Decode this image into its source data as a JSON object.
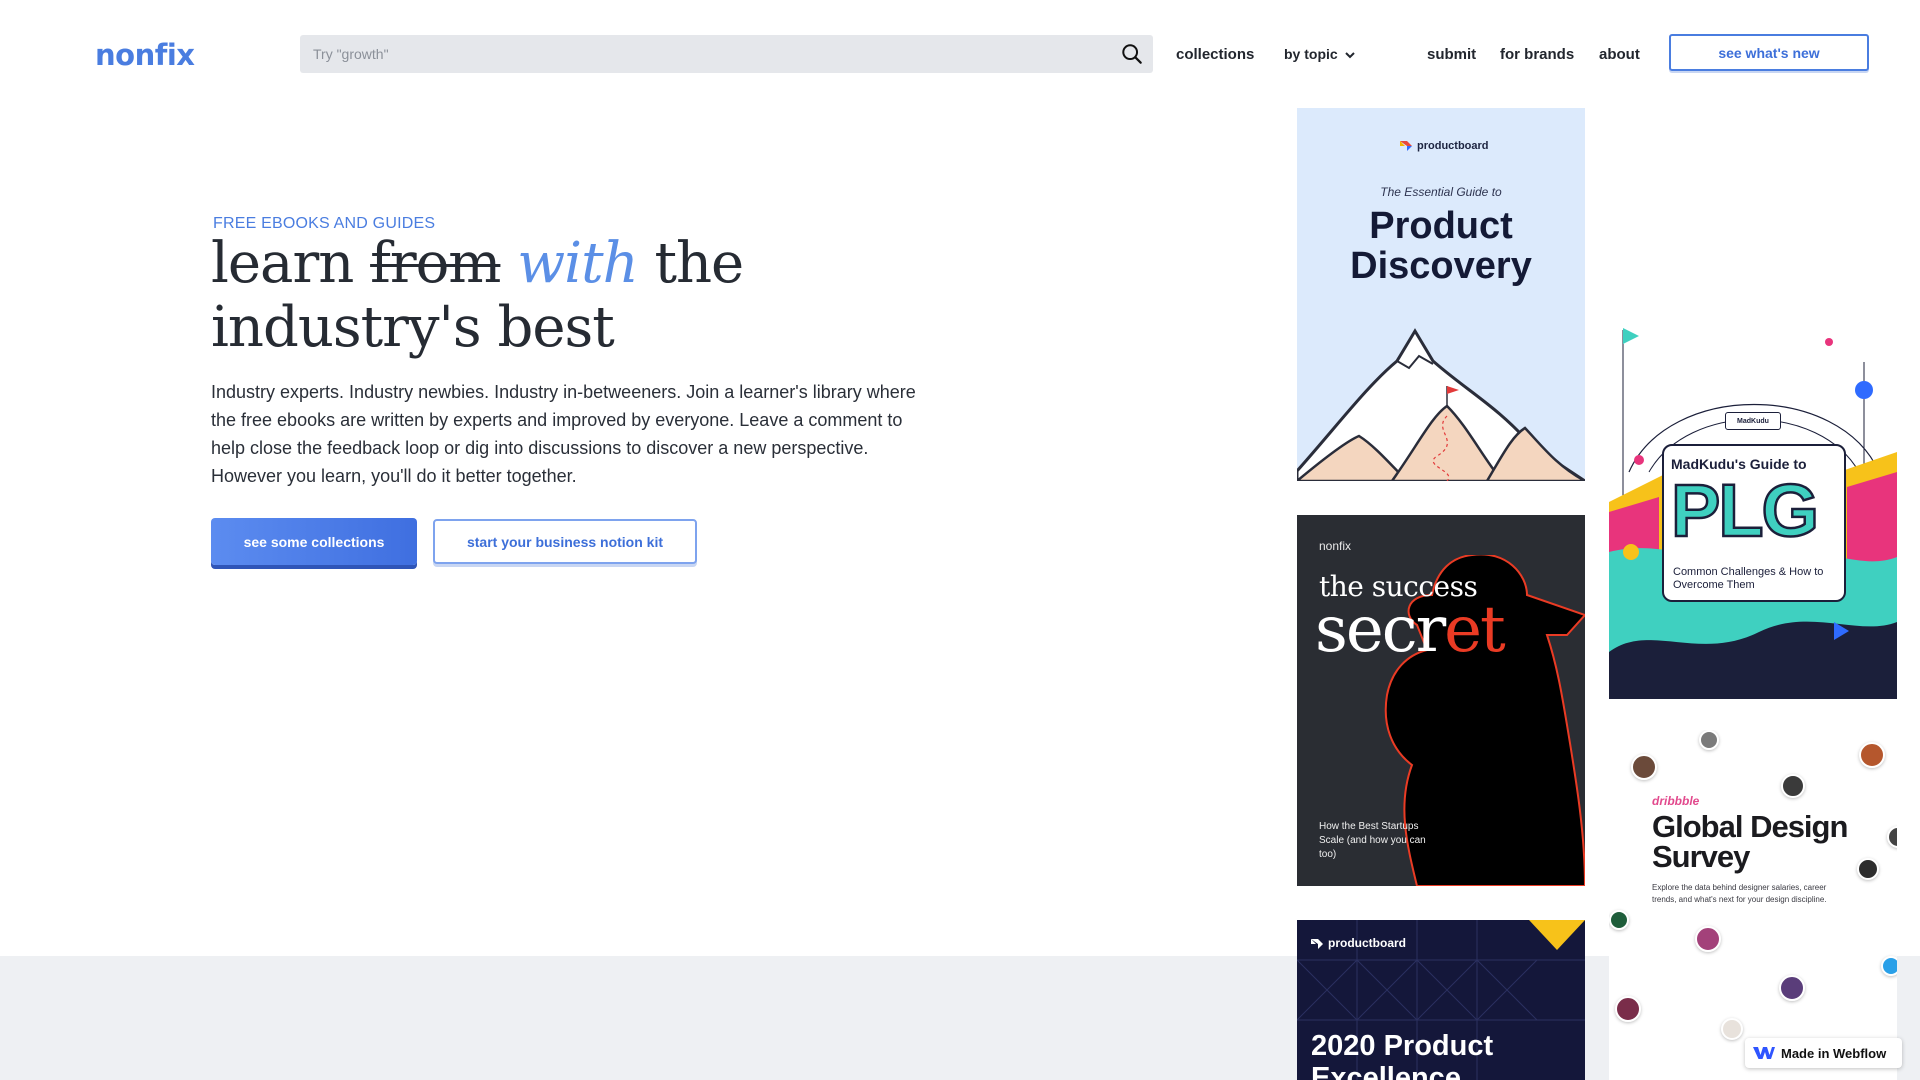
{
  "header": {
    "logo_text": "nonfi",
    "logo_mark": "x",
    "search_placeholder": "Try \"growth\"",
    "search_value": "",
    "nav": {
      "collections": "collections",
      "by_topic": "by topic",
      "submit": "submit",
      "for_brands": "for brands",
      "about": "about",
      "cta": "see what's new"
    }
  },
  "hero": {
    "eyebrow": "FREE EBOOKS AND GUIDES",
    "headline_word1": "learn",
    "headline_struck": "from",
    "headline_accent": "with",
    "headline_rest1": "the",
    "headline_line2": "industry's best",
    "intro": "Industry experts. Industry newbies. Industry in-betweeners. Join a learner's library where the free ebooks are written by experts and improved by everyone. Leave a comment to help close the feedback loop or dig into discussions to discover a new perspective. However you learn, you'll do it better together.",
    "primary_button": "see some collections",
    "secondary_button": "start your business notion kit"
  },
  "cards": {
    "product_discovery": {
      "brand": "productboard",
      "subtitle": "The Essential Guide to",
      "title_line1": "Product",
      "title_line2": "Discovery"
    },
    "success_secret": {
      "brand": "nonfix",
      "line1": "the success",
      "line2_a": "secr",
      "line2_b": "et",
      "tagline": "How the Best Startups Scale (and how you can too)"
    },
    "product_excellence": {
      "brand": "productboard",
      "title_line1": "2020 Product",
      "title_line2": "Excellence"
    },
    "plg": {
      "tag": "MadKudu",
      "kicker": "MadKudu's Guide to",
      "big": "PLG",
      "sub": "Common Challenges & How to Overcome Them"
    },
    "design_survey": {
      "brand": "dribbble",
      "title_line1": "Global Design",
      "title_line2": "Survey",
      "sub": "Explore the data behind designer salaries, career trends, and what's next for your design discipline."
    }
  },
  "badge": {
    "webflow": "Made in Webflow"
  },
  "colors": {
    "brand_blue": "#4a7de0",
    "accent_italic": "#5b8fe6",
    "ink": "#262b33",
    "grey_band": "#eef0f3"
  },
  "icons": {
    "search": "search-icon",
    "chevron": "chevron-down-icon",
    "webflow": "webflow-icon"
  }
}
